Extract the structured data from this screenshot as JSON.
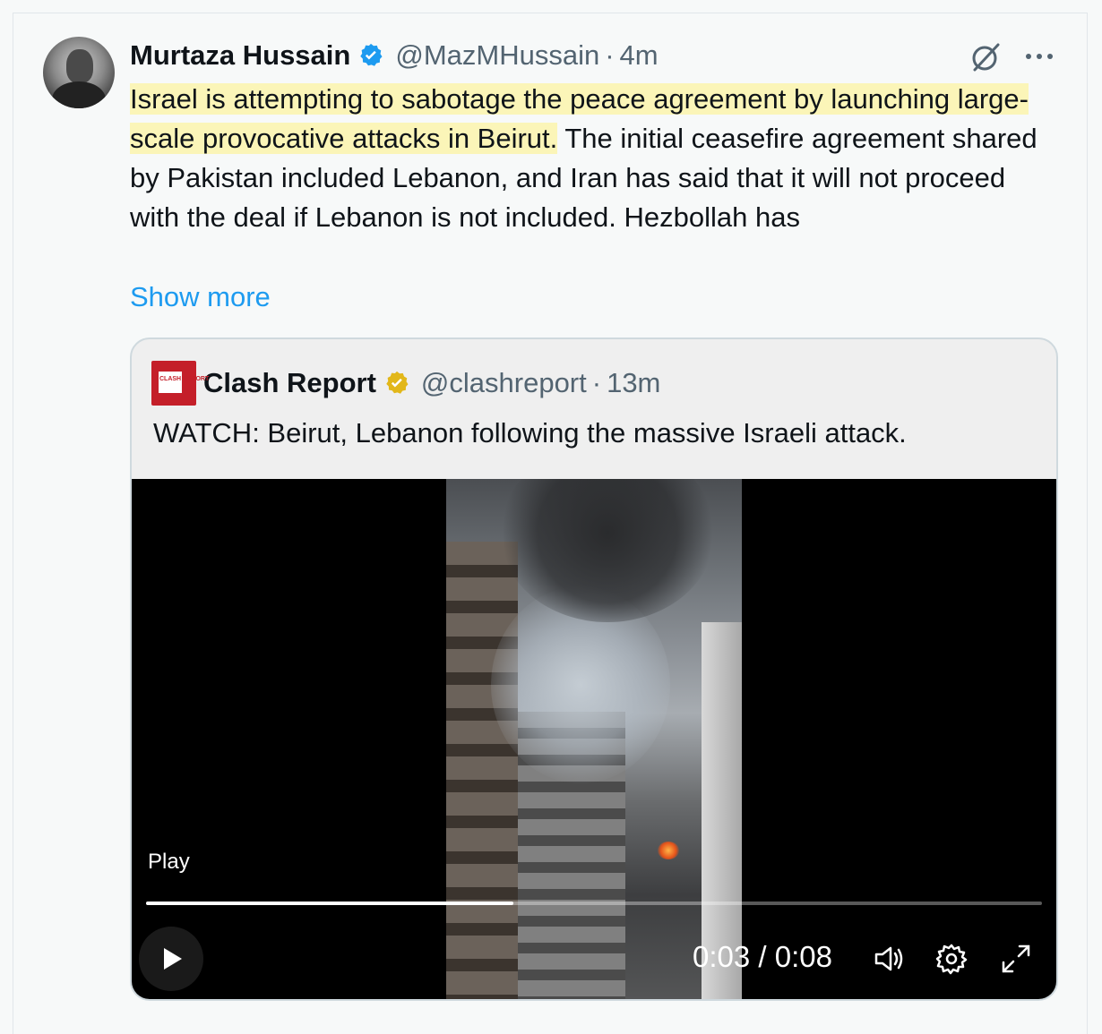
{
  "post": {
    "author_name": "Murtaza Hussain",
    "handle": "@MazMHussain",
    "separator": "·",
    "time": "4m",
    "text_highlighted": "Israel is attempting to sabotage the peace agreement by launching large-scale provocative attacks in Beirut.",
    "text_rest": " The initial ceasefire agreement shared by Pakistan included Lebanon, and Iran has said that it will not proceed with the deal if Lebanon is not included. Hezbollah has",
    "show_more": "Show more",
    "icons": {
      "verified": "verified-badge-icon",
      "grok": "grok-icon",
      "more": "more-icon"
    }
  },
  "quote": {
    "author_name": "Clash Report",
    "logo_text": "CLASH REPORT",
    "handle": "@clashreport",
    "separator": "·",
    "time": "13m",
    "text": "WATCH: Beirut, Lebanon following the massive Israeli attack."
  },
  "video": {
    "play_label": "Play",
    "current_time": "0:03",
    "time_separator": "/",
    "duration": "0:08",
    "progress": 0.41,
    "icons": [
      "play-icon",
      "volume-icon",
      "settings-icon",
      "fullscreen-icon"
    ]
  },
  "colors": {
    "link": "#1d9bf0",
    "highlight": "#fbf5b8",
    "verified_blue": "#1d9bf0",
    "verified_gold": "#e2b719",
    "logo_red": "#c41f29"
  }
}
